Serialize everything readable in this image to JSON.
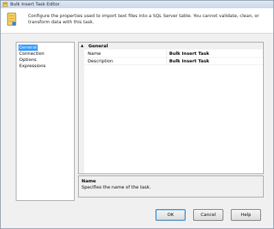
{
  "window": {
    "title": "Bulk Insert Task Editor",
    "icon": "task-icon"
  },
  "header": {
    "icon": "bulk-insert-icon",
    "description": "Configure the properties used to import text files into a SQL Server table. You cannot validate, clean, or transform data with this task."
  },
  "nav": {
    "items": [
      {
        "label": "General",
        "selected": true
      },
      {
        "label": "Connection",
        "selected": false
      },
      {
        "label": "Options",
        "selected": false
      },
      {
        "label": "Expressions",
        "selected": false
      }
    ]
  },
  "grid": {
    "category": {
      "label": "General",
      "toggle": "▲"
    },
    "rows": [
      {
        "name": "Name",
        "value": "Bulk Insert Task"
      },
      {
        "name": "Description",
        "value": "Bulk Insert Task"
      }
    ]
  },
  "help": {
    "title": "Name",
    "description": "Specifies the name of the task."
  },
  "buttons": {
    "ok": "OK",
    "cancel": "Cancel",
    "help": "Help"
  },
  "colors": {
    "selection": "#3399ff",
    "title_gradient_top": "#dfe9f5"
  }
}
